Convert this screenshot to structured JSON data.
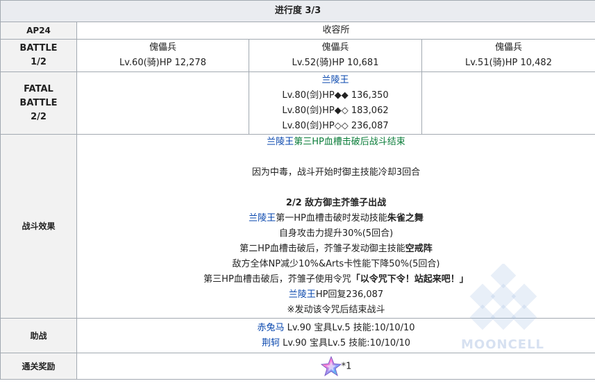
{
  "progress": "进行度 3/3",
  "ap": {
    "label": "AP24",
    "location": "收容所"
  },
  "battle": {
    "label": "BATTLE",
    "index": "1/2",
    "enemies": [
      {
        "name": "傀儡兵",
        "stat": "Lv.60(骑)HP 12,278"
      },
      {
        "name": "傀儡兵",
        "stat": "Lv.52(骑)HP 10,681"
      },
      {
        "name": "傀儡兵",
        "stat": "Lv.51(骑)HP 10,482"
      }
    ]
  },
  "fatal_battle": {
    "label": "FATAL BATTLE",
    "index": "2/2",
    "boss_name": "兰陵王",
    "bars": [
      "Lv.80(剑)HP◆◆ 136,350",
      "Lv.80(剑)HP◆◇ 183,062",
      "Lv.80(剑)HP◇◇ 236,087"
    ]
  },
  "effects": {
    "label": "战斗效果",
    "l1_name": "兰陵王",
    "l1_text": "第三HP血槽击破后战斗结束",
    "l2": "因为中毒，战斗开始时御主技能冷却3回合",
    "l3": "2/2 敌方御主芥雏子出战",
    "l4_name": "兰陵王",
    "l4_text": "第一HP血槽击破时发动技能",
    "l4_skill": "朱雀之舞",
    "l5": "自身攻击力提升30%(5回合)",
    "l6_text": "第二HP血槽击破后，芥雏子发动御主技能",
    "l6_skill": "空戒阵",
    "l7": "敌方全体NP减少10%&Arts卡性能下降50%(5回合)",
    "l8_text": "第三HP血槽击破后，芥雏子使用令咒",
    "l8_bold": "「以令咒下令！站起来吧！」",
    "l9_name": "兰陵王",
    "l9_text": "HP回复236,087",
    "l10": "※发动该令咒后结束战斗"
  },
  "support": {
    "label": "助战",
    "rows": [
      {
        "name": "赤兔马",
        "detail": " Lv.90 宝具Lv.5 技能:10/10/10"
      },
      {
        "name": "荆轲",
        "detail": " Lv.90 宝具Lv.5 技能:10/10/10"
      }
    ]
  },
  "reward": {
    "label": "通关奖励",
    "count": "*1"
  },
  "watermark": "MOONCELL",
  "colors": {
    "link": "#0645ad",
    "green_link": "#0b7d3a",
    "header_bg": "#eaecf0",
    "border": "#a2a9b1"
  }
}
